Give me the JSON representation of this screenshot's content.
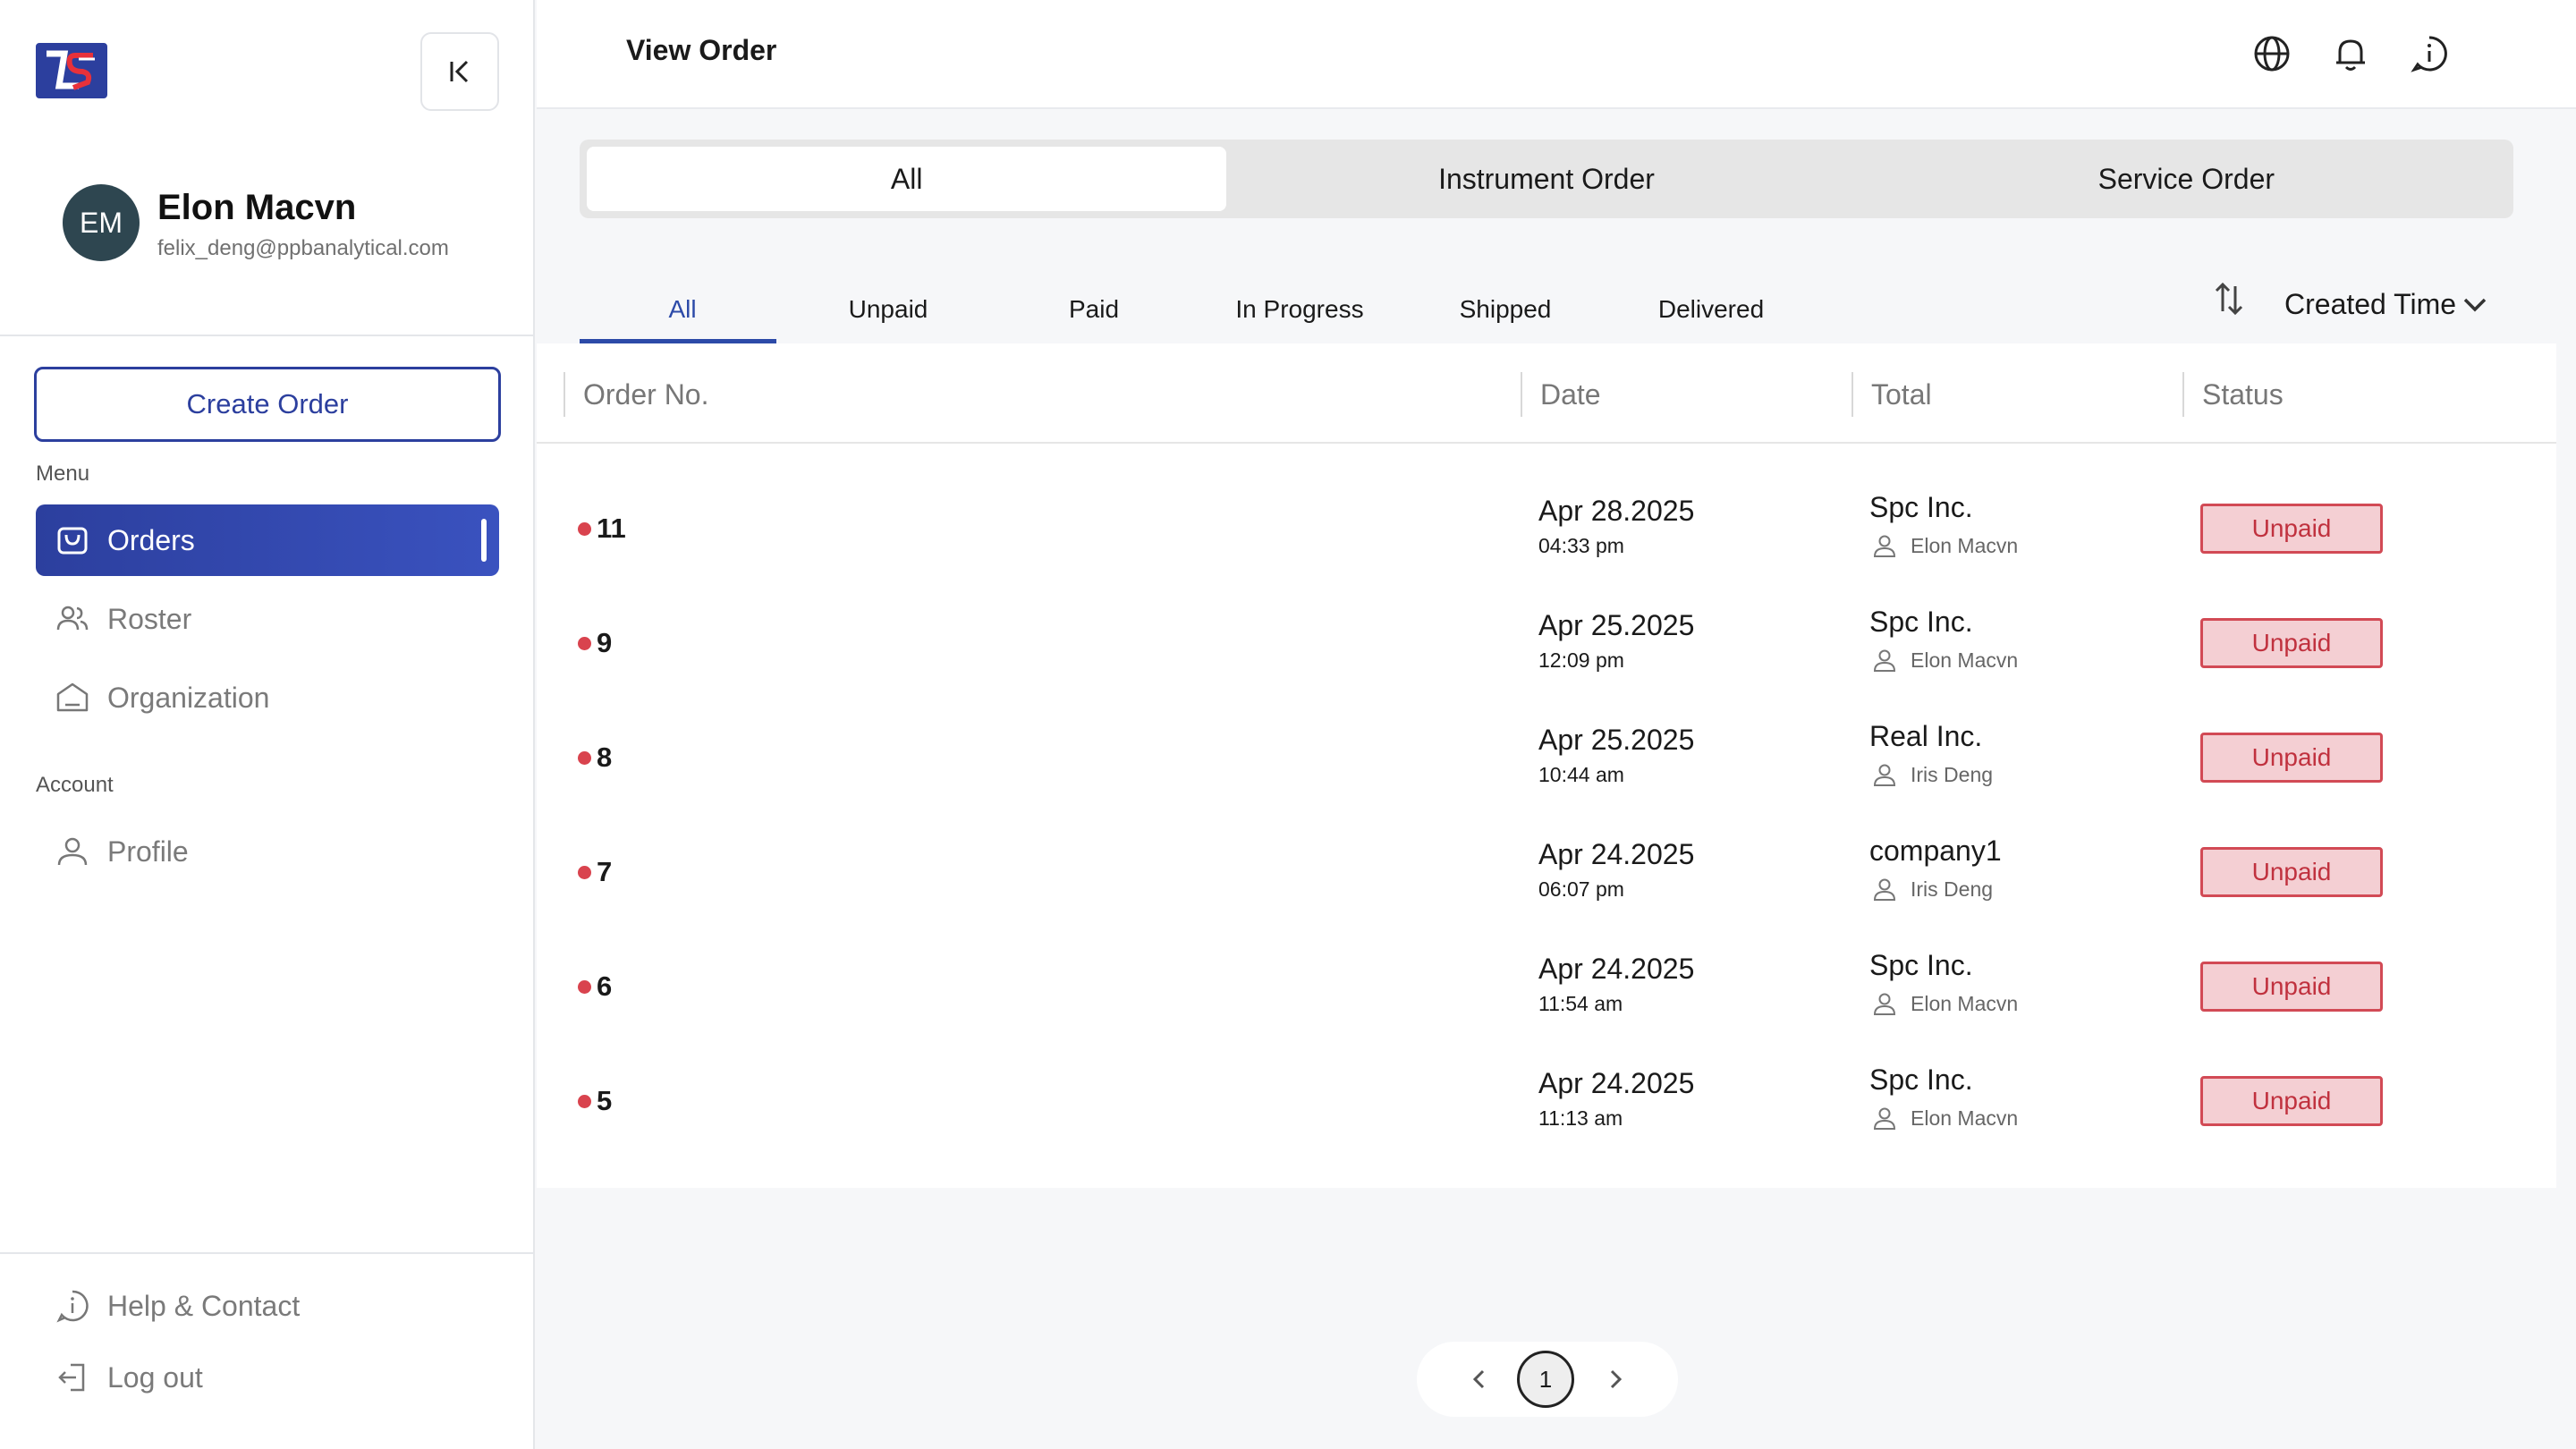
{
  "app": {
    "logo_alt": "LS logo"
  },
  "sidebar": {
    "user": {
      "initials": "EM",
      "name": "Elon Macvn",
      "email": "felix_deng@ppbanalytical.com"
    },
    "create_order_label": "Create Order",
    "menu_label": "Menu",
    "menu_items": [
      {
        "label": "Orders",
        "icon": "shopping-bag-icon",
        "active": true
      },
      {
        "label": "Roster",
        "icon": "users-icon",
        "active": false
      },
      {
        "label": "Organization",
        "icon": "building-icon",
        "active": false
      }
    ],
    "account_label": "Account",
    "account_items": [
      {
        "label": "Profile",
        "icon": "user-icon"
      }
    ],
    "footer_items": [
      {
        "label": "Help & Contact",
        "icon": "info-chat-icon"
      },
      {
        "label": "Log out",
        "icon": "logout-icon"
      }
    ]
  },
  "header": {
    "title": "View Order",
    "icons": [
      "globe-icon",
      "bell-icon",
      "info-chat-icon"
    ]
  },
  "order_type_tabs": [
    {
      "label": "All",
      "active": true
    },
    {
      "label": "Instrument Order",
      "active": false
    },
    {
      "label": "Service Order",
      "active": false
    }
  ],
  "status_tabs": [
    {
      "label": "All",
      "active": true
    },
    {
      "label": "Unpaid",
      "active": false
    },
    {
      "label": "Paid",
      "active": false
    },
    {
      "label": "In Progress",
      "active": false
    },
    {
      "label": "Shipped",
      "active": false
    },
    {
      "label": "Delivered",
      "active": false
    }
  ],
  "sort": {
    "label": "Created Time"
  },
  "table": {
    "columns": [
      "Order No.",
      "Date",
      "Total",
      "Status"
    ],
    "rows": [
      {
        "order_no": "11",
        "date": "Apr 28.2025",
        "time": "04:33 pm",
        "company": "Spc Inc.",
        "person": "Elon Macvn",
        "status": "Unpaid"
      },
      {
        "order_no": "9",
        "date": "Apr 25.2025",
        "time": "12:09 pm",
        "company": "Spc Inc.",
        "person": "Elon Macvn",
        "status": "Unpaid"
      },
      {
        "order_no": "8",
        "date": "Apr 25.2025",
        "time": "10:44 am",
        "company": "Real Inc.",
        "person": "Iris Deng",
        "status": "Unpaid"
      },
      {
        "order_no": "7",
        "date": "Apr 24.2025",
        "time": "06:07 pm",
        "company": "company1",
        "person": "Iris Deng",
        "status": "Unpaid"
      },
      {
        "order_no": "6",
        "date": "Apr 24.2025",
        "time": "11:54 am",
        "company": "Spc Inc.",
        "person": "Elon Macvn",
        "status": "Unpaid"
      },
      {
        "order_no": "5",
        "date": "Apr 24.2025",
        "time": "11:13 am",
        "company": "Spc Inc.",
        "person": "Elon Macvn",
        "status": "Unpaid"
      }
    ]
  },
  "pagination": {
    "current_page": "1"
  },
  "colors": {
    "primary": "#2c3f9e",
    "unpaid_fill": "#f4cfd3",
    "unpaid_border": "#d24a55",
    "dot": "#d9434e"
  }
}
